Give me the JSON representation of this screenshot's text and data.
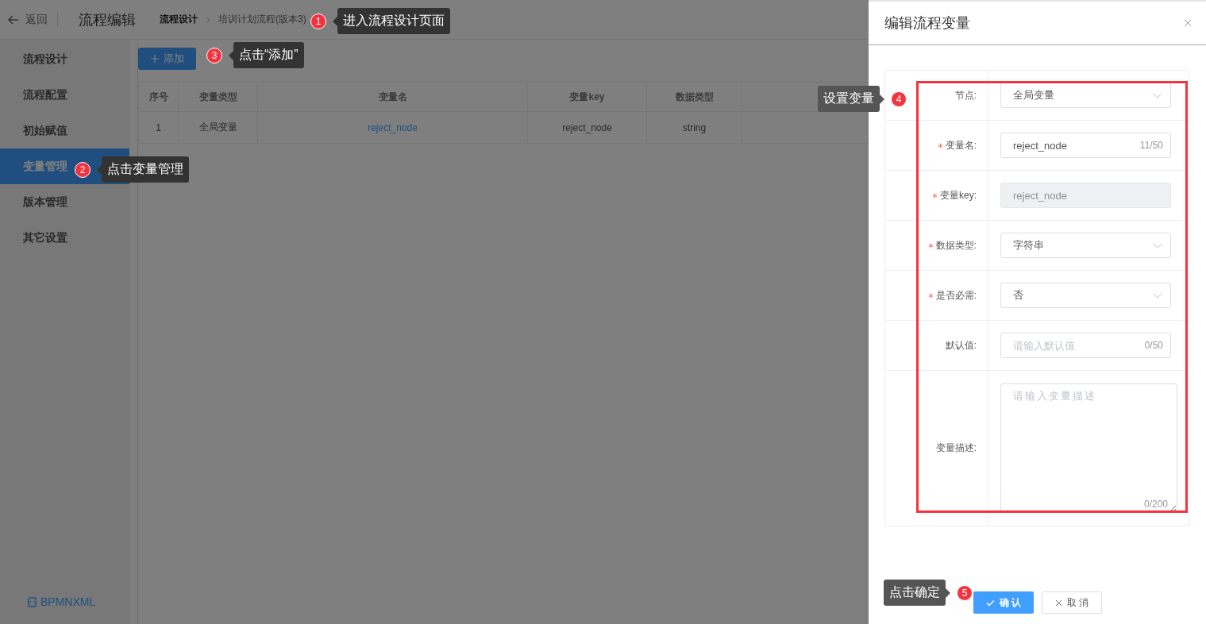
{
  "header": {
    "back": "返回",
    "title": "流程编辑",
    "breadcrumb": [
      "流程设计",
      "培训计划流程(版本3)"
    ]
  },
  "sidebar": {
    "items": [
      {
        "label": "流程设计",
        "selected": false
      },
      {
        "label": "流程配置",
        "selected": false
      },
      {
        "label": "初始赋值",
        "selected": false
      },
      {
        "label": "变量管理",
        "selected": true
      },
      {
        "label": "版本管理",
        "selected": false
      },
      {
        "label": "其它设置",
        "selected": false
      }
    ],
    "footer_link": "BPMNXML"
  },
  "toolbar": {
    "add_button": "添加"
  },
  "table": {
    "columns": [
      {
        "label": "序号",
        "kind": "text"
      },
      {
        "label": "变量类型",
        "kind": "text"
      },
      {
        "label": "变量名",
        "kind": "link"
      },
      {
        "label": "变量key",
        "kind": "text"
      },
      {
        "label": "数据类型",
        "kind": "text"
      }
    ],
    "rows": [
      [
        "1",
        "全局变量",
        "reject_node",
        "reject_node",
        "string"
      ]
    ]
  },
  "drawer": {
    "title": "编辑流程变量",
    "form": [
      {
        "label": "节点:",
        "required": false,
        "kind": "select",
        "disabled": false,
        "value": "全局变量"
      },
      {
        "label": "变量名:",
        "required": true,
        "kind": "input",
        "disabled": false,
        "value": "reject_node",
        "counter": "11/50"
      },
      {
        "label": "变量key:",
        "required": true,
        "kind": "input",
        "disabled": true,
        "value": "reject_node"
      },
      {
        "label": "数据类型:",
        "required": true,
        "kind": "select",
        "disabled": false,
        "value": "字符串"
      },
      {
        "label": "是否必需:",
        "required": true,
        "kind": "select",
        "disabled": false,
        "value": "否"
      },
      {
        "label": "默认值:",
        "required": false,
        "kind": "input",
        "disabled": false,
        "placeholder": "请输入默认值",
        "counter": "0/50"
      },
      {
        "label": "变量描述:",
        "required": false,
        "kind": "textarea",
        "disabled": false,
        "placeholder": "请输入变量描述",
        "counter": "0/200"
      }
    ],
    "buttons": [
      {
        "label": "确 认",
        "kind": "primary"
      },
      {
        "label": "取 消",
        "kind": "default"
      }
    ]
  },
  "annotations": [
    {
      "number": "1",
      "text": "进入流程设计页面"
    },
    {
      "number": "2",
      "text": "点击变量管理"
    },
    {
      "number": "3",
      "text": "点击“添加”"
    },
    {
      "number": "4",
      "text": "设置变量"
    },
    {
      "number": "5",
      "text": "点击确定"
    }
  ]
}
